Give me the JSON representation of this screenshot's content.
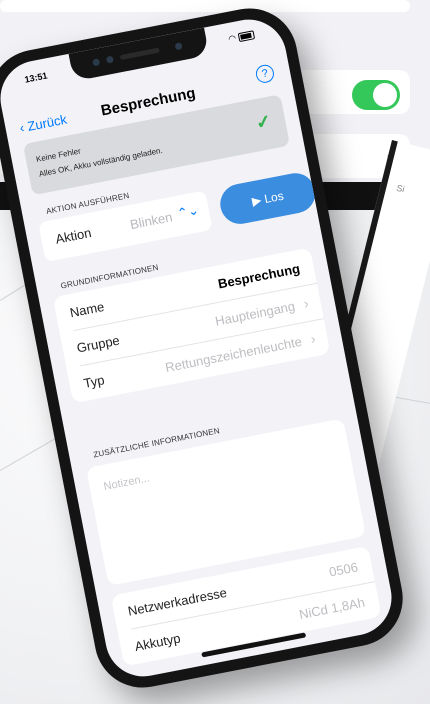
{
  "phone": {
    "statusbar": {
      "time": "13:51"
    },
    "nav": {
      "back_label": "Zurück",
      "title": "Besprechung",
      "help_glyph": "?"
    },
    "status": {
      "line1": "Keine Fehler",
      "line2": "Alles OK, Akku vollständig geladen.",
      "icon": "checkmark-icon"
    },
    "action": {
      "section_header": "AKTION AUSFÜHREN",
      "label": "Aktion",
      "value": "Blinken",
      "run_button": "Los"
    },
    "basic": {
      "section_header": "GRUNDINFORMATIONEN",
      "rows": [
        {
          "key": "Name",
          "value": "Besprechung"
        },
        {
          "key": "Gruppe",
          "value": "Haupteingang"
        },
        {
          "key": "Typ",
          "value": "Rettungszeichenleuchte"
        }
      ]
    },
    "additional": {
      "section_header": "ZUSÄTZLICHE INFORMATIONEN",
      "notes_placeholder": "Notizen...",
      "rows": [
        {
          "key": "Netzwerkadresse",
          "value": "0506"
        },
        {
          "key": "Akkutyp",
          "value": "NiCd 1,8Ah"
        }
      ]
    }
  },
  "background": {
    "tablet_toggle": "on",
    "laptop_text": "Si"
  },
  "colors": {
    "accent": "#007aff",
    "run_button": "#3b8de0",
    "success": "#34c759"
  }
}
